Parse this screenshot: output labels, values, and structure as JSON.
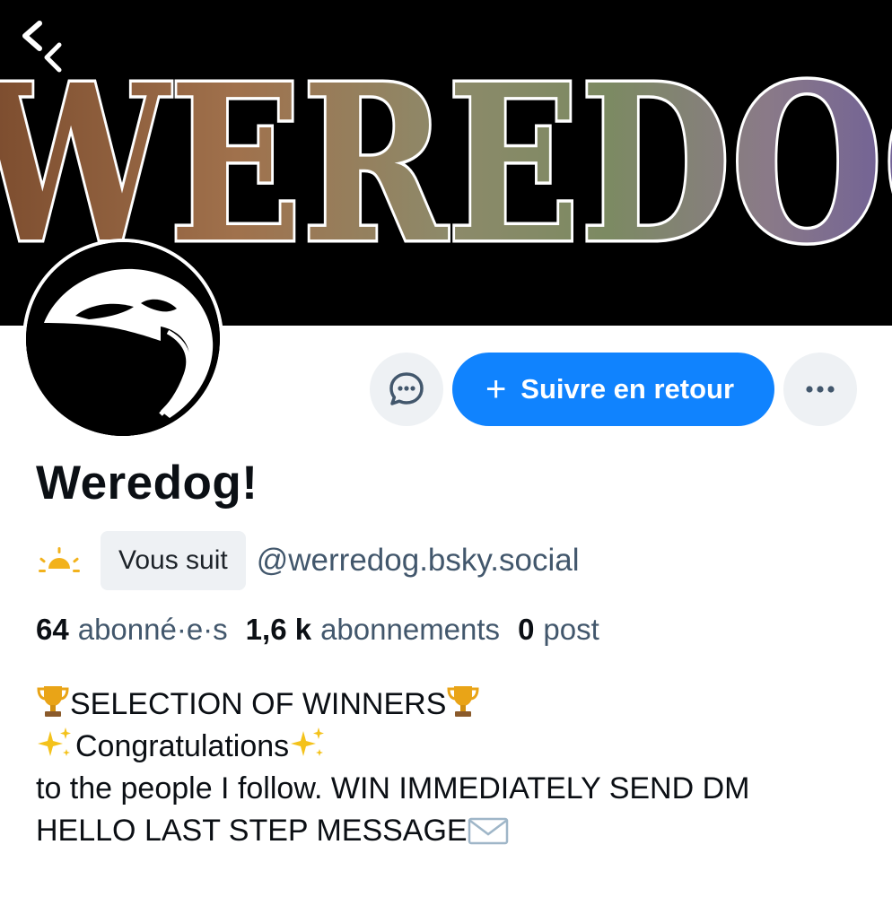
{
  "banner": {
    "word": "WEREDOG"
  },
  "profile": {
    "display_name": "Weredog!",
    "follows_you_label": "Vous suit",
    "handle": "@werredog.bsky.social",
    "status_icon": "sunrise-icon"
  },
  "actions": {
    "message_icon": "chat-bubble-icon",
    "follow_label": "Suivre en retour",
    "more_icon": "ellipsis-icon"
  },
  "stats": {
    "followers_count": "64",
    "followers_label": "abonné·e·s",
    "following_count": "1,6 k",
    "following_label": "abonnements",
    "posts_count": "0",
    "posts_label": "post"
  },
  "bio": {
    "line1": "SELECTION OF WINNERS",
    "line2": "Congratulations",
    "line3": "to the people I follow. WIN IMMEDIATELY SEND DM",
    "line4": "HELLO LAST STEP MESSAGE"
  },
  "colors": {
    "accent": "#1083fe",
    "muted_text": "#42576c",
    "button_bg": "#eef1f4"
  }
}
